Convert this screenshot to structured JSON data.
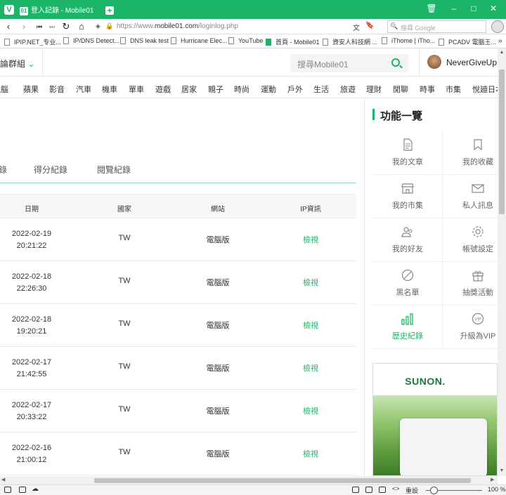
{
  "browser": {
    "tab_title": "登入記錄 - Mobile01",
    "url_prefix": "https://www.",
    "url_domain": "mobile01.com",
    "url_path": "/loginlog.php",
    "search_placeholder": "搜尋 Google"
  },
  "bookmarks": [
    "IPIP.NET_专业...",
    "IP/DNS Detect...",
    "DNS leak test",
    "Hurricane Elec...",
    "YouTube",
    "首頁 - Mobile01",
    "資安人科技網 ...",
    "iThome | iTho...",
    "PCADV 電腦王..."
  ],
  "header": {
    "group_label": "討論群組",
    "search_placeholder": "搜尋Mobile01",
    "username": "NeverGiveUp!!"
  },
  "categories": [
    "電腦",
    "蘋果",
    "影音",
    "汽車",
    "機車",
    "單車",
    "遊戲",
    "居家",
    "親子",
    "時尚",
    "運動",
    "戶外",
    "生活",
    "旅遊",
    "理財",
    "閒聊",
    "時事",
    "市集",
    "悅廸日本"
  ],
  "subtabs": [
    "錄",
    "得分紀錄",
    "閱覽紀錄"
  ],
  "table": {
    "headers": [
      "日期",
      "國家",
      "網站",
      "IP資訊"
    ],
    "rows": [
      {
        "date": "2022-02-19",
        "time": "20:21:22",
        "country": "TW",
        "site": "電腦版",
        "ip": "檢視"
      },
      {
        "date": "2022-02-18",
        "time": "22:26:30",
        "country": "TW",
        "site": "電腦版",
        "ip": "檢視"
      },
      {
        "date": "2022-02-18",
        "time": "19:20:21",
        "country": "TW",
        "site": "電腦版",
        "ip": "檢視"
      },
      {
        "date": "2022-02-17",
        "time": "21:42:55",
        "country": "TW",
        "site": "電腦版",
        "ip": "檢視"
      },
      {
        "date": "2022-02-17",
        "time": "20:33:22",
        "country": "TW",
        "site": "電腦版",
        "ip": "檢視"
      },
      {
        "date": "2022-02-16",
        "time": "21:00:12",
        "country": "TW",
        "site": "電腦版",
        "ip": "檢視"
      }
    ]
  },
  "sidebar": {
    "title": "功能一覽",
    "items": [
      {
        "label": "我的文章",
        "icon": "document-icon"
      },
      {
        "label": "我的收藏",
        "icon": "bookmark-icon"
      },
      {
        "label": "我的市集",
        "icon": "store-icon"
      },
      {
        "label": "私人訊息",
        "icon": "envelope-icon"
      },
      {
        "label": "我的好友",
        "icon": "friends-icon"
      },
      {
        "label": "帳號設定",
        "icon": "gear-icon"
      },
      {
        "label": "黑名單",
        "icon": "block-icon"
      },
      {
        "label": "抽獎活動",
        "icon": "gift-icon"
      },
      {
        "label": "歷史紀錄",
        "icon": "bar-chart-icon",
        "active": true
      },
      {
        "label": "升級為VIP",
        "icon": "vip-icon"
      }
    ],
    "ad_brand": "SUNON."
  },
  "status": {
    "zoom_label": "重設",
    "zoom_value": "100 %"
  },
  "colors": {
    "accent": "#1cb568"
  }
}
